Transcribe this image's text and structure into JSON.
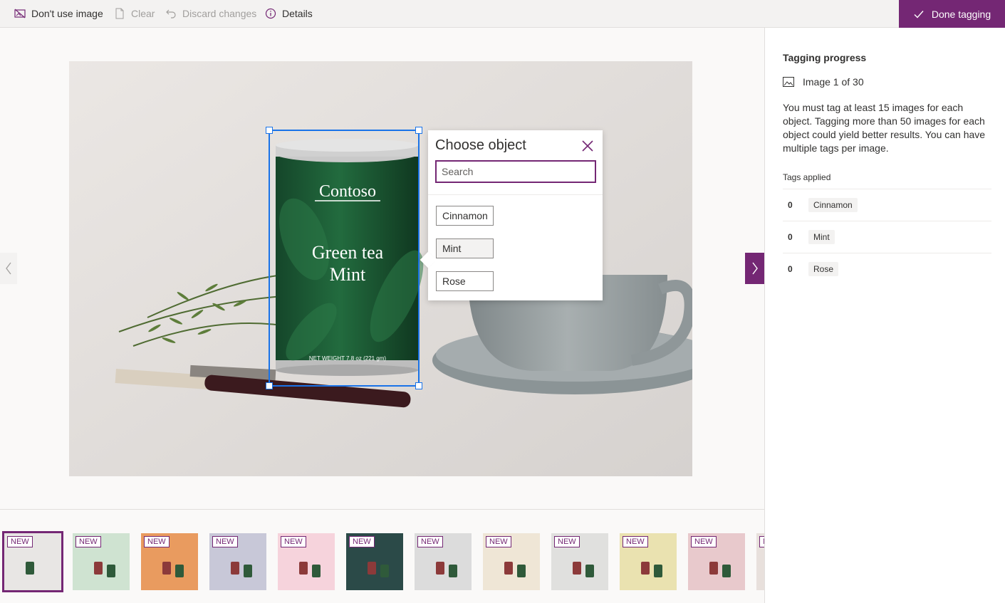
{
  "toolbar": {
    "dont_use_image": "Don't use image",
    "clear": "Clear",
    "discard_changes": "Discard changes",
    "details": "Details",
    "done_tagging": "Done tagging"
  },
  "popup": {
    "title": "Choose object",
    "search_placeholder": "Search",
    "options": [
      "Cinnamon",
      "Mint",
      "Rose"
    ]
  },
  "panel": {
    "title": "Tagging progress",
    "image_count": "Image 1 of 30",
    "description": "You must tag at least 15 images for each object. Tagging more than 50 images for each object could yield better results. You can have multiple tags per image.",
    "tags_applied_label": "Tags applied",
    "tags": [
      {
        "count": "0",
        "name": "Cinnamon"
      },
      {
        "count": "0",
        "name": "Mint"
      },
      {
        "count": "0",
        "name": "Rose"
      }
    ]
  },
  "product": {
    "brand": "Contoso",
    "name_line1": "Green tea",
    "name_line2": "Mint",
    "net_weight": "NET WEIGHT 7.8 oz (221 gm)"
  },
  "filmstrip": {
    "badge": "NEW",
    "thumbs": [
      {
        "bg": "#e8e6e4",
        "selected": true
      },
      {
        "bg": "#cfe3d1"
      },
      {
        "bg": "#e99b5f"
      },
      {
        "bg": "#c8c8d8"
      },
      {
        "bg": "#f6d3dc"
      },
      {
        "bg": "#2b4a48"
      },
      {
        "bg": "#dcdcdc"
      },
      {
        "bg": "#efe6d6"
      },
      {
        "bg": "#e0e0de"
      },
      {
        "bg": "#eae2b0"
      },
      {
        "bg": "#e8c9cc"
      },
      {
        "bg": "#e8e0dc"
      }
    ]
  },
  "colors": {
    "accent": "#742774",
    "selection": "#1a73e8"
  }
}
